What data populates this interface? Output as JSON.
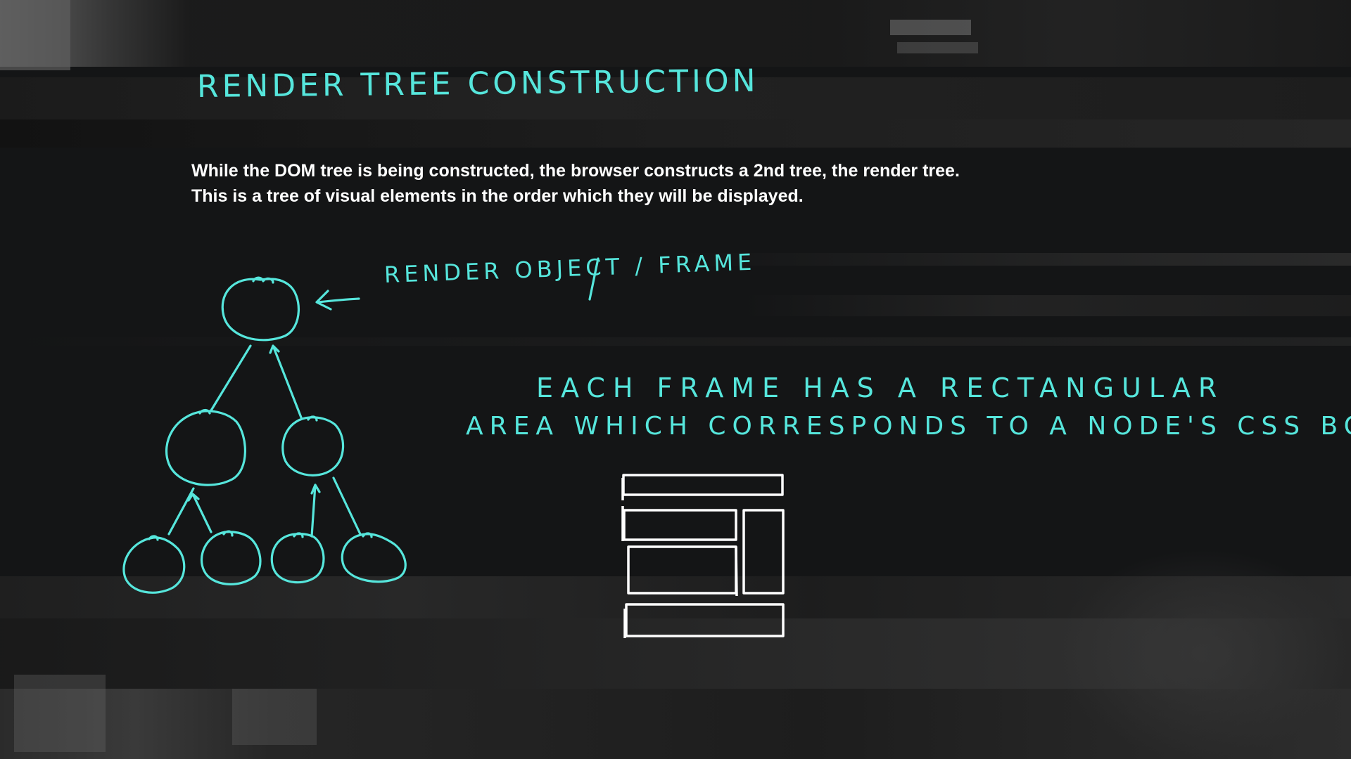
{
  "slide": {
    "title": "RENDER TREE CONSTRUCTION",
    "intro_line_1": "While the DOM tree is being constructed, the browser constructs a 2nd tree, the render tree.",
    "intro_line_2": "This is a tree of visual elements in the order which they will be displayed."
  },
  "annotations": {
    "render_object_label": "RENDER OBJECT / FRAME",
    "frame_line_1": "EACH FRAME HAS A RECTANGULAR",
    "frame_line_2": "AREA WHICH CORRESPONDS TO A NODE'S CSS BOX."
  },
  "colors": {
    "background": "#141516",
    "handwriting": "#56e6dc",
    "body_text": "#ffffff",
    "box_outline": "#ffffff"
  },
  "icons": {
    "arrow": "left-arrow-icon"
  }
}
